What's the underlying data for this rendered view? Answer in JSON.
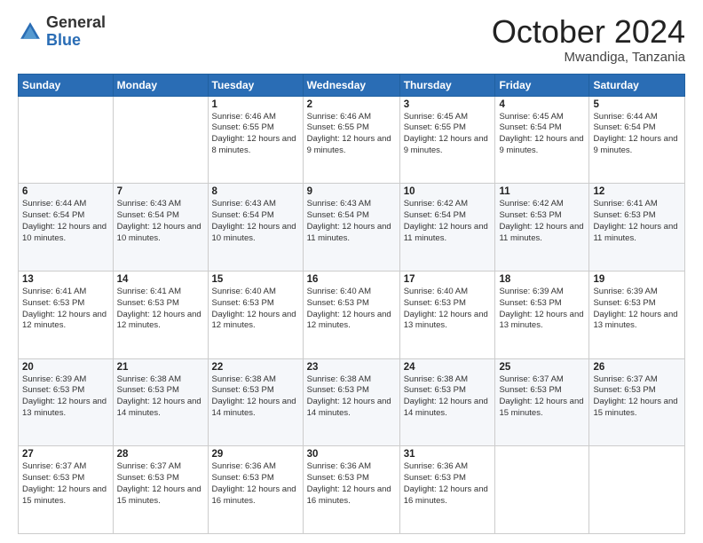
{
  "header": {
    "logo_general": "General",
    "logo_blue": "Blue",
    "month_title": "October 2024",
    "location": "Mwandiga, Tanzania"
  },
  "columns": [
    "Sunday",
    "Monday",
    "Tuesday",
    "Wednesday",
    "Thursday",
    "Friday",
    "Saturday"
  ],
  "weeks": [
    [
      {
        "day": "",
        "info": ""
      },
      {
        "day": "",
        "info": ""
      },
      {
        "day": "1",
        "info": "Sunrise: 6:46 AM\nSunset: 6:55 PM\nDaylight: 12 hours and 8 minutes."
      },
      {
        "day": "2",
        "info": "Sunrise: 6:46 AM\nSunset: 6:55 PM\nDaylight: 12 hours and 9 minutes."
      },
      {
        "day": "3",
        "info": "Sunrise: 6:45 AM\nSunset: 6:55 PM\nDaylight: 12 hours and 9 minutes."
      },
      {
        "day": "4",
        "info": "Sunrise: 6:45 AM\nSunset: 6:54 PM\nDaylight: 12 hours and 9 minutes."
      },
      {
        "day": "5",
        "info": "Sunrise: 6:44 AM\nSunset: 6:54 PM\nDaylight: 12 hours and 9 minutes."
      }
    ],
    [
      {
        "day": "6",
        "info": "Sunrise: 6:44 AM\nSunset: 6:54 PM\nDaylight: 12 hours and 10 minutes."
      },
      {
        "day": "7",
        "info": "Sunrise: 6:43 AM\nSunset: 6:54 PM\nDaylight: 12 hours and 10 minutes."
      },
      {
        "day": "8",
        "info": "Sunrise: 6:43 AM\nSunset: 6:54 PM\nDaylight: 12 hours and 10 minutes."
      },
      {
        "day": "9",
        "info": "Sunrise: 6:43 AM\nSunset: 6:54 PM\nDaylight: 12 hours and 11 minutes."
      },
      {
        "day": "10",
        "info": "Sunrise: 6:42 AM\nSunset: 6:54 PM\nDaylight: 12 hours and 11 minutes."
      },
      {
        "day": "11",
        "info": "Sunrise: 6:42 AM\nSunset: 6:53 PM\nDaylight: 12 hours and 11 minutes."
      },
      {
        "day": "12",
        "info": "Sunrise: 6:41 AM\nSunset: 6:53 PM\nDaylight: 12 hours and 11 minutes."
      }
    ],
    [
      {
        "day": "13",
        "info": "Sunrise: 6:41 AM\nSunset: 6:53 PM\nDaylight: 12 hours and 12 minutes."
      },
      {
        "day": "14",
        "info": "Sunrise: 6:41 AM\nSunset: 6:53 PM\nDaylight: 12 hours and 12 minutes."
      },
      {
        "day": "15",
        "info": "Sunrise: 6:40 AM\nSunset: 6:53 PM\nDaylight: 12 hours and 12 minutes."
      },
      {
        "day": "16",
        "info": "Sunrise: 6:40 AM\nSunset: 6:53 PM\nDaylight: 12 hours and 12 minutes."
      },
      {
        "day": "17",
        "info": "Sunrise: 6:40 AM\nSunset: 6:53 PM\nDaylight: 12 hours and 13 minutes."
      },
      {
        "day": "18",
        "info": "Sunrise: 6:39 AM\nSunset: 6:53 PM\nDaylight: 12 hours and 13 minutes."
      },
      {
        "day": "19",
        "info": "Sunrise: 6:39 AM\nSunset: 6:53 PM\nDaylight: 12 hours and 13 minutes."
      }
    ],
    [
      {
        "day": "20",
        "info": "Sunrise: 6:39 AM\nSunset: 6:53 PM\nDaylight: 12 hours and 13 minutes."
      },
      {
        "day": "21",
        "info": "Sunrise: 6:38 AM\nSunset: 6:53 PM\nDaylight: 12 hours and 14 minutes."
      },
      {
        "day": "22",
        "info": "Sunrise: 6:38 AM\nSunset: 6:53 PM\nDaylight: 12 hours and 14 minutes."
      },
      {
        "day": "23",
        "info": "Sunrise: 6:38 AM\nSunset: 6:53 PM\nDaylight: 12 hours and 14 minutes."
      },
      {
        "day": "24",
        "info": "Sunrise: 6:38 AM\nSunset: 6:53 PM\nDaylight: 12 hours and 14 minutes."
      },
      {
        "day": "25",
        "info": "Sunrise: 6:37 AM\nSunset: 6:53 PM\nDaylight: 12 hours and 15 minutes."
      },
      {
        "day": "26",
        "info": "Sunrise: 6:37 AM\nSunset: 6:53 PM\nDaylight: 12 hours and 15 minutes."
      }
    ],
    [
      {
        "day": "27",
        "info": "Sunrise: 6:37 AM\nSunset: 6:53 PM\nDaylight: 12 hours and 15 minutes."
      },
      {
        "day": "28",
        "info": "Sunrise: 6:37 AM\nSunset: 6:53 PM\nDaylight: 12 hours and 15 minutes."
      },
      {
        "day": "29",
        "info": "Sunrise: 6:36 AM\nSunset: 6:53 PM\nDaylight: 12 hours and 16 minutes."
      },
      {
        "day": "30",
        "info": "Sunrise: 6:36 AM\nSunset: 6:53 PM\nDaylight: 12 hours and 16 minutes."
      },
      {
        "day": "31",
        "info": "Sunrise: 6:36 AM\nSunset: 6:53 PM\nDaylight: 12 hours and 16 minutes."
      },
      {
        "day": "",
        "info": ""
      },
      {
        "day": "",
        "info": ""
      }
    ]
  ]
}
